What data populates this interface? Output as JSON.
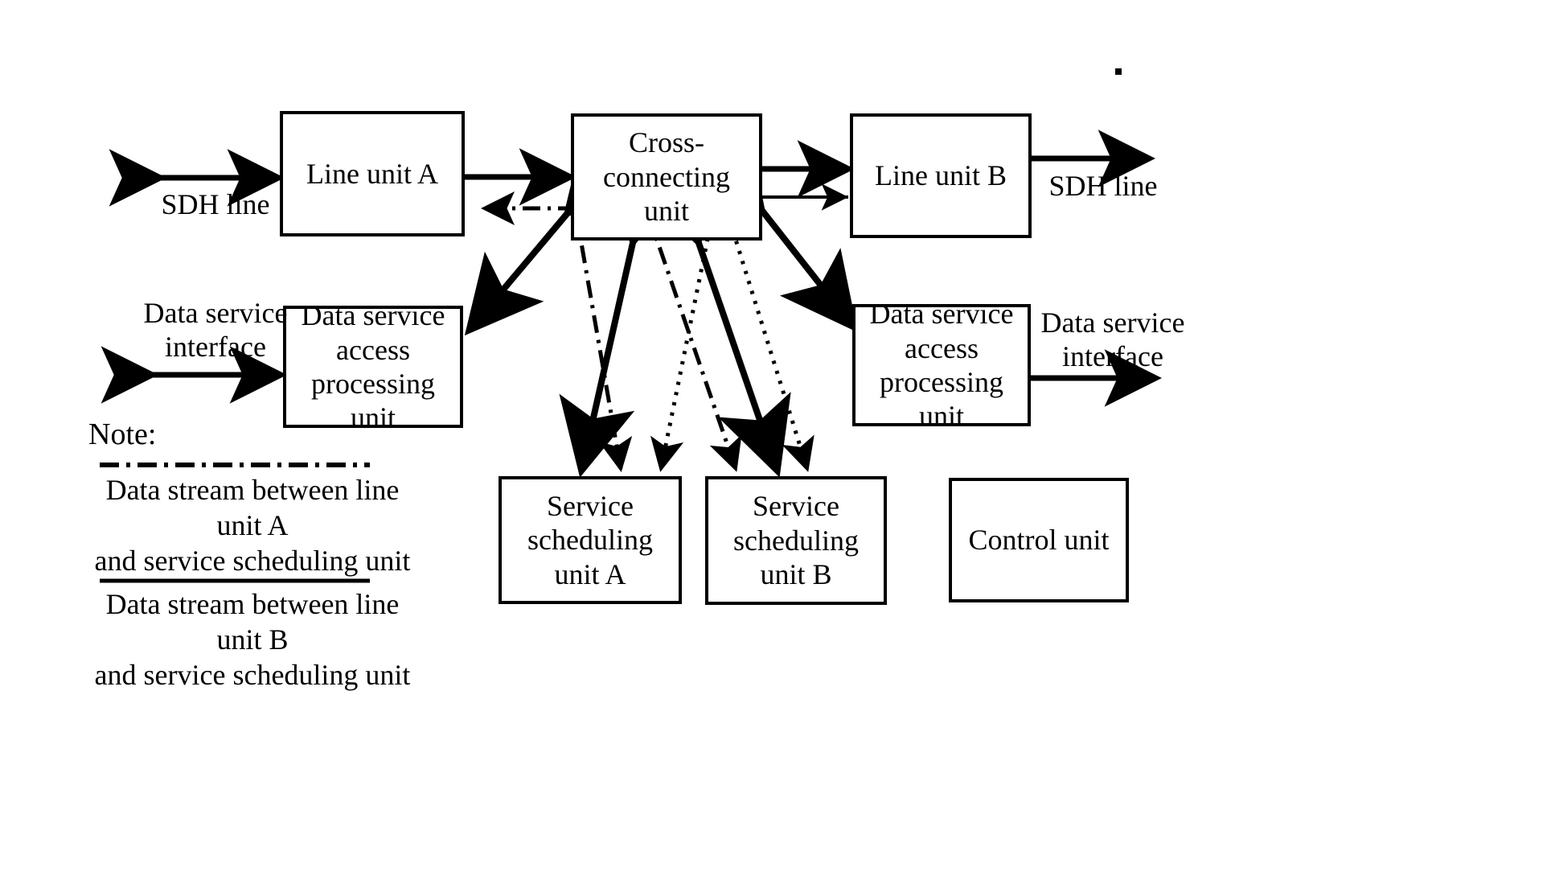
{
  "diagram": {
    "title_absent": true,
    "boxes": [
      {
        "id": "line-unit-a",
        "label": "Line\nunit A"
      },
      {
        "id": "cross-connecting-unit",
        "label": "Cross-\nconnecting\nunit"
      },
      {
        "id": "line-unit-b",
        "label": "Line unit B"
      },
      {
        "id": "data-service-access-processing-unit-left",
        "label": "Data service\naccess\nprocessing unit"
      },
      {
        "id": "data-service-access-processing-unit-right",
        "label": "Data service\naccess\nprocessing unit"
      },
      {
        "id": "service-scheduling-unit-a",
        "label": "Service\nscheduling\nunit A"
      },
      {
        "id": "service-scheduling-unit-b",
        "label": "Service\nscheduling\nunit B"
      },
      {
        "id": "control-unit",
        "label": "Control unit"
      }
    ],
    "labels": {
      "sdh_line_left": "SDH line",
      "sdh_line_right": "SDH line",
      "data_service_interface_left": "Data service\ninterface",
      "data_service_interface_right": "Data service\ninterface"
    },
    "note": {
      "heading": "Note:",
      "entries": [
        {
          "line_style": "dash-dot",
          "text": "Data stream between line unit A\nand service scheduling unit"
        },
        {
          "line_style": "solid",
          "text": "Data stream between line unit B\nand service scheduling unit"
        }
      ]
    },
    "colors": {
      "stroke": "#000000",
      "background": "#ffffff"
    },
    "connections": [
      {
        "from": "external-sdh-left",
        "to": "line-unit-a",
        "style": "solid",
        "arrows": "both"
      },
      {
        "from": "line-unit-a",
        "to": "cross-connecting-unit",
        "style": "solid",
        "arrows": "both"
      },
      {
        "from": "cross-connecting-unit",
        "to": "line-unit-a",
        "style": "dash-dot",
        "arrows": "end"
      },
      {
        "from": "cross-connecting-unit",
        "to": "line-unit-b",
        "style": "solid",
        "arrows": "both"
      },
      {
        "from": "cross-connecting-unit",
        "to": "line-unit-b",
        "style": "solid-thin",
        "arrows": "end"
      },
      {
        "from": "line-unit-b",
        "to": "external-sdh-right",
        "style": "solid",
        "arrows": "both"
      },
      {
        "from": "cross-connecting-unit",
        "to": "data-service-access-processing-unit-left",
        "style": "solid",
        "arrows": "both"
      },
      {
        "from": "cross-connecting-unit",
        "to": "data-service-access-processing-unit-right",
        "style": "solid",
        "arrows": "both"
      },
      {
        "from": "external-dsi-left",
        "to": "data-service-access-processing-unit-left",
        "style": "solid",
        "arrows": "both"
      },
      {
        "from": "data-service-access-processing-unit-right",
        "to": "external-dsi-right",
        "style": "solid",
        "arrows": "both"
      },
      {
        "from": "cross-connecting-unit",
        "to": "service-scheduling-unit-a",
        "style": "solid",
        "arrows": "both"
      },
      {
        "from": "cross-connecting-unit",
        "to": "service-scheduling-unit-a",
        "style": "dash-dot",
        "arrows": "end"
      },
      {
        "from": "cross-connecting-unit",
        "to": "service-scheduling-unit-a",
        "style": "dotted",
        "arrows": "end"
      },
      {
        "from": "cross-connecting-unit",
        "to": "service-scheduling-unit-b",
        "style": "solid",
        "arrows": "both"
      },
      {
        "from": "cross-connecting-unit",
        "to": "service-scheduling-unit-b",
        "style": "dash-dot",
        "arrows": "end"
      },
      {
        "from": "cross-connecting-unit",
        "to": "service-scheduling-unit-b",
        "style": "dotted",
        "arrows": "end"
      }
    ]
  }
}
